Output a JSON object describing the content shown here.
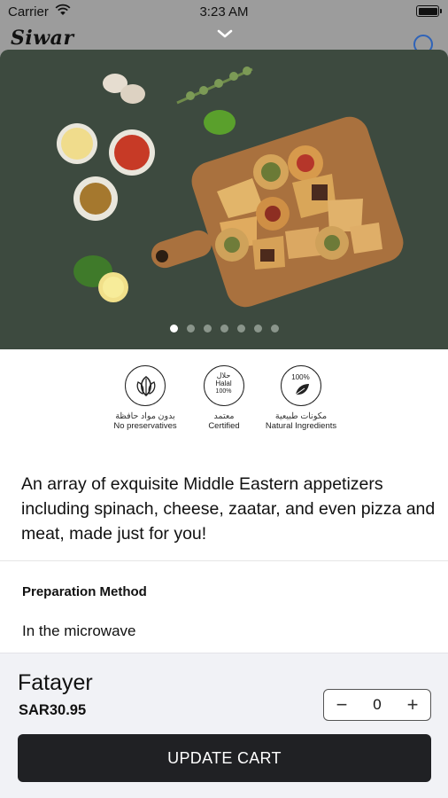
{
  "status_bar": {
    "carrier": "Carrier",
    "time": "3:23 AM"
  },
  "background_header": {
    "logo": "Siwar"
  },
  "product": {
    "image_alt": "Fatayer assortment on wooden board",
    "carousel": {
      "count": 7,
      "active_index": 0
    },
    "badges": [
      {
        "icon": "leaf-icon",
        "arabic": "بدون مواد حافظة",
        "english": "No preservatives"
      },
      {
        "icon": "halal-icon",
        "arabic": "معتمد",
        "english": "Certified",
        "seal_text": [
          "حلال",
          "Halal",
          "100%"
        ]
      },
      {
        "icon": "natural-leaf-icon",
        "arabic": "مكونات طبيعية",
        "english": "Natural Ingredients",
        "seal_text": [
          "100%"
        ]
      }
    ],
    "description": "An array of exquisite Middle Eastern appetizers including spinach, cheese, zaatar, and even pizza and meat, made just for you!",
    "preparation": {
      "title": "Preparation Method",
      "value": "In the microwave"
    },
    "name": "Fatayer",
    "price": "SAR30.95",
    "quantity": "0",
    "minus_label": "−",
    "plus_label": "+",
    "update_label": "UPDATE CART"
  },
  "colors": {
    "hero_bg": "#3d4a3f",
    "button_bg": "#202124",
    "panel_bg": "#f1f2f6",
    "overlay": "#9c9c9c"
  }
}
